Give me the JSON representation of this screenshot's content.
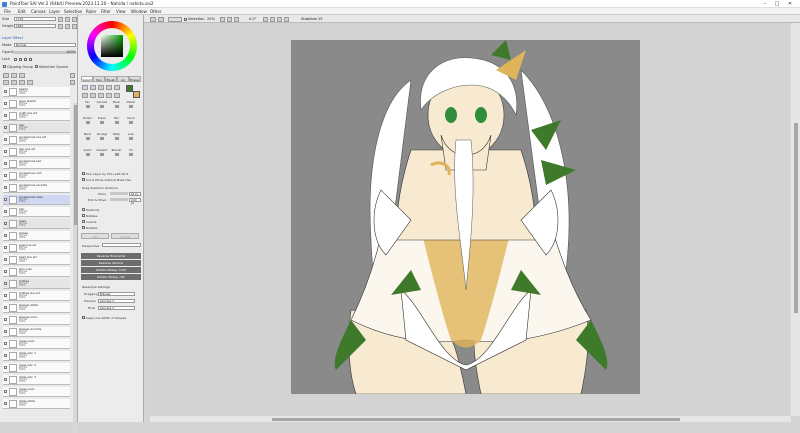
{
  "window": {
    "title": "PaintTool SAI Ver.2 (64bit) Preview.2023.11.20 - Nahida / nahida.sai2",
    "controls": [
      "–",
      "□",
      "✕"
    ]
  },
  "menu": [
    "File",
    "Edit",
    "Canvas",
    "Layer",
    "Selection",
    "Ruler",
    "Filter",
    "View",
    "Window",
    "Other"
  ],
  "toolbar": {
    "selection_label": "Selection",
    "zoom": "25%",
    "angle": "0.0°",
    "stabilizer_label": "Stabilizer",
    "stabilizer_value": "15"
  },
  "left": {
    "size_label": "Size",
    "size_value": "1719",
    "height_label": "Height",
    "height_value": "1640",
    "effect_label": "Layer Effect",
    "mode_label": "Mode",
    "mode_value": "Normal",
    "opacity_label": "Opacity",
    "opacity_value": "100%",
    "lock_label": "Lock",
    "clipping_label": "Clipping Group",
    "selection_source_label": "Selection Source"
  },
  "layers": [
    {
      "name": "hearts",
      "sub": "Normal\n100%",
      "folder": false
    },
    {
      "name": "layer sketch",
      "sub": "Normal\n100%",
      "folder": false
    },
    {
      "name": "multi line art",
      "sub": "Multiply\n100%",
      "folder": false
    },
    {
      "name": "hair",
      "sub": "Normal\n100%",
      "folder": true
    },
    {
      "name": "accessories line art",
      "sub": "Normal\n100%",
      "folder": false
    },
    {
      "name": "hair line art",
      "sub": "Normal\n100%",
      "folder": false
    },
    {
      "name": "accessories hair",
      "sub": "Normal\n100%",
      "folder": false
    },
    {
      "name": "accessories mid",
      "sub": "Normal\n100%",
      "folder": false
    },
    {
      "name": "accessories accents",
      "sub": "Normal\n100%",
      "folder": false
    },
    {
      "name": "accessories main",
      "sub": "Normal\n100%",
      "folder": false,
      "selected": true
    },
    {
      "name": "hair",
      "sub": "Normal\n100%",
      "folder": false
    },
    {
      "name": "head",
      "sub": "Normal\n100%",
      "folder": true
    },
    {
      "name": "lashes",
      "sub": "Normal\n100%",
      "folder": false
    },
    {
      "name": "eyes line art",
      "sub": "Normal\n100%",
      "folder": false
    },
    {
      "name": "head line art",
      "sub": "Normal\n100%",
      "folder": false
    },
    {
      "name": "skin color",
      "sub": "Normal\n100%",
      "folder": false
    },
    {
      "name": "clothes",
      "sub": "Normal\n100%",
      "folder": true
    },
    {
      "name": "clothes line art",
      "sub": "Normal\n100%",
      "folder": false
    },
    {
      "name": "sleeves white",
      "sub": "Normal\n100%",
      "folder": false
    },
    {
      "name": "sleeves main",
      "sub": "Normal\n100%",
      "folder": false
    },
    {
      "name": "sleeves accents",
      "sub": "Normal\n100%",
      "folder": false
    },
    {
      "name": "dress main",
      "sub": "Normal\n100%",
      "folder": false
    },
    {
      "name": "dress adv. 1",
      "sub": "Normal\n100%",
      "folder": false
    },
    {
      "name": "dress adv. 2",
      "sub": "Normal\n100%",
      "folder": false
    },
    {
      "name": "dress adv. 3",
      "sub": "Normal\n100%",
      "folder": false
    },
    {
      "name": "dress main",
      "sub": "Normal\n100%",
      "folder": false
    },
    {
      "name": "dress white",
      "sub": "Normal\n100%",
      "folder": false
    }
  ],
  "tools": {
    "tabs": [
      "Select",
      "Pen",
      "Brush",
      "Air",
      "Eraser"
    ],
    "grid": [
      "Pen",
      "Airbrush",
      "Brush",
      "Marker",
      "Marker",
      "Eraser",
      "Blur",
      "Pencil",
      "Blend",
      "Smudge",
      "Water",
      "Liner",
      "Select",
      "Deselect",
      "Blender",
      "Fill"
    ],
    "pick_layer_label": "Pick Layer by Ctrl+Left Click",
    "cut_move_label": "Cut & Move without Mask Hex",
    "drag_distance_label": "Drag Selection Distance",
    "move_label": "Move",
    "move_value": "64 px",
    "pick_move_label": "Pick & Move",
    "pick_move_value": "4.00 px",
    "options": [
      "Positions",
      "Rotates",
      "Inverts",
      "Rotates"
    ],
    "ok_label": "OK",
    "cancel_label": "Cancel",
    "perspective_label": "Perspective",
    "buttons": [
      "Reverse Horizontal",
      "Reverse Vertical",
      "Rotate 90deg. CCW",
      "Rotate 90deg. CW"
    ],
    "resample_label": "Resample Settings",
    "dragging_label": "Dragging",
    "dragging_value": "Bilinear",
    "preview_label": "Preview",
    "preview_value": "Lanczos 3",
    "final_label": "Final",
    "final_value": "Lanczos 3",
    "keep_line_label": "Keep Line Width of Shapes"
  },
  "colors": {
    "hair": "#ffffff",
    "skin": "#f7ead1",
    "green": "#3e7a2a",
    "gold": "#e0b45a",
    "eye": "#2f8d3c",
    "doc_bg": "#8a8a8a"
  }
}
